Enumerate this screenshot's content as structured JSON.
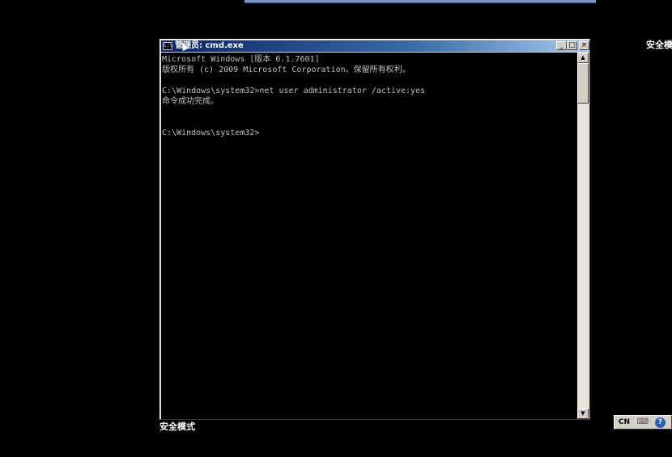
{
  "corner_text": "安全模",
  "safe_mode_label": "安全模式",
  "window": {
    "title": "管理员: cmd.exe",
    "icon_text": "C:\\",
    "controls": {
      "minimize": "_",
      "maximize": "□",
      "close": "×"
    }
  },
  "console": {
    "lines": [
      "Microsoft Windows [版本 6.1.7601]",
      "版权所有 (c) 2009 Microsoft Corporation。保留所有权利。",
      "",
      "C:\\Windows\\system32>net user administrator /active:yes",
      "命令成功完成。",
      "",
      "",
      "C:\\Windows\\system32>"
    ]
  },
  "scrollbar": {
    "up_glyph": "▲",
    "down_glyph": "▼"
  },
  "language_bar": {
    "lang": "CN",
    "keyboard_glyph": "⌨",
    "help_glyph": "?"
  }
}
